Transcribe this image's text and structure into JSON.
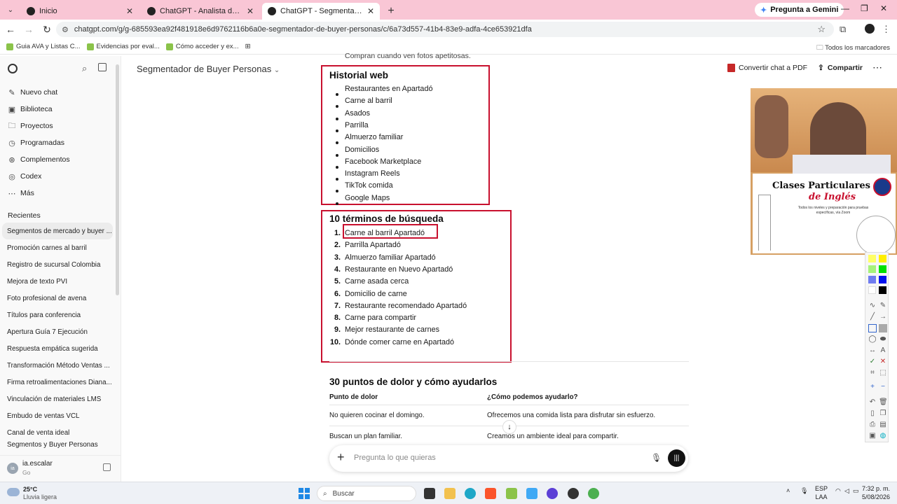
{
  "browser": {
    "tabs": [
      {
        "title": "Inicio",
        "active": false
      },
      {
        "title": "ChatGPT - Analista de Productos",
        "active": false
      },
      {
        "title": "ChatGPT - Segmentador de Buyer",
        "active": true
      }
    ],
    "gemini_button": "Pregunta a Gemini",
    "url": "chatgpt.com/g/g-685593ea92f481918e6d9762116b6a0e-segmentador-de-buyer-personas/c/6a73d557-41b4-83e9-adfa-4ce653921dfa",
    "bookmarks": [
      "Guia AVA y Listas C...",
      "Evidencias por eval...",
      "Cómo acceder y ex..."
    ],
    "all_bookmarks": "Todos los marcadores"
  },
  "sidebar": {
    "nav": [
      {
        "label": "Nuevo chat",
        "icon": "edit-icon"
      },
      {
        "label": "Biblioteca",
        "icon": "library-icon"
      },
      {
        "label": "Proyectos",
        "icon": "folder-icon"
      },
      {
        "label": "Programadas",
        "icon": "clock-icon"
      },
      {
        "label": "Complementos",
        "icon": "plugin-icon"
      },
      {
        "label": "Codex",
        "icon": "codex-icon"
      },
      {
        "label": "Más",
        "icon": "dots-icon"
      }
    ],
    "recents_label": "Recientes",
    "recents": [
      "Segmentos de mercado y buyer ...",
      "Promoción carnes al barril",
      "Registro de sucursal Colombia",
      "Mejora de texto PVI",
      "Foto profesional de avena",
      "Títulos para conferencia",
      "Apertura Guía 7 Ejecución",
      "Respuesta empática sugerida",
      "Transformación Método Ventas ...",
      "Firma retroalimentaciones Diana...",
      "Vinculación de materiales LMS",
      "Embudo de ventas VCL",
      "Canal de venta ideal",
      "Segmentos y Buyer Personas"
    ],
    "user": {
      "initials": "ia",
      "name": "ia.escalar",
      "plan": "Go"
    }
  },
  "header": {
    "title": "Segmentador de Buyer Personas",
    "pdf_button": "Convertir chat a PDF",
    "share_button": "Compartir"
  },
  "content": {
    "faded_text": "Compran cuando ven fotos apetitosas.",
    "web_history": {
      "title": "Historial web",
      "items": [
        "Restaurantes en Apartadó",
        "Carne al barril",
        "Asados",
        "Parrilla",
        "Almuerzo familiar",
        "Domicilios",
        "Facebook Marketplace",
        "Instagram Reels",
        "TikTok comida",
        "Google Maps"
      ]
    },
    "search_terms": {
      "title": "10 términos de búsqueda",
      "items": [
        "Carne al barril Apartadó",
        "Parrilla Apartadó",
        "Almuerzo familiar Apartadó",
        "Restaurante en Nuevo Apartadó",
        "Carne asada cerca",
        "Domicilio de carne",
        "Restaurante recomendado Apartadó",
        "Carne para compartir",
        "Mejor restaurante de carnes",
        "Dónde comer carne en Apartadó"
      ]
    },
    "pain_points": {
      "title": "30 puntos de dolor y cómo ayudarlos",
      "columns": [
        "Punto de dolor",
        "¿Cómo podemos ayudarlo?"
      ],
      "rows": [
        [
          "No quieren cocinar el domingo.",
          "Ofrecemos una comida lista para disfrutar sin esfuerzo."
        ],
        [
          "Buscan un plan familiar.",
          "Creamos un ambiente ideal para compartir."
        ]
      ]
    }
  },
  "composer": {
    "placeholder": "Pregunta lo que quieras"
  },
  "webcam": {
    "title_line1": "Clases Particulares",
    "title_line2": "de Inglés",
    "subtitle": "Todos los niveles y preparación para pruebas específicas, vía Zoom"
  },
  "taskbar": {
    "temp": "25°C",
    "weather": "Lluvia ligera",
    "search": "Buscar",
    "lang1": "ESP",
    "lang2": "LAA",
    "time": "7:32 p. m.",
    "date": "5/08/2026"
  },
  "colors": {
    "accent_red": "#c8102e",
    "tab_strip": "#f9c6d5"
  }
}
